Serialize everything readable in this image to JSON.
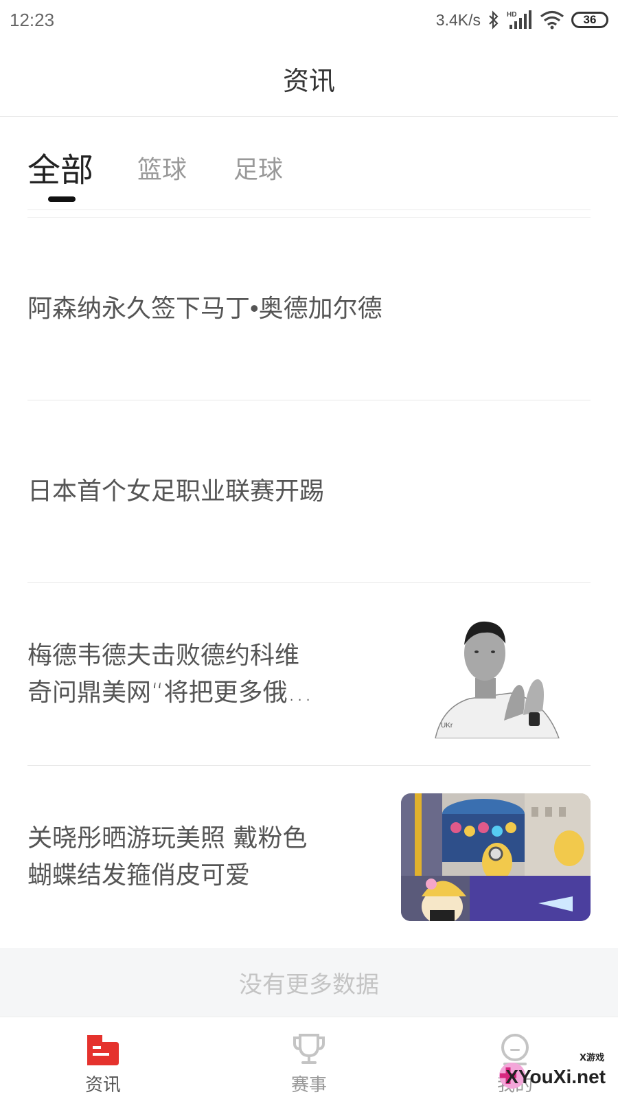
{
  "status_bar": {
    "time": "12:23",
    "speed": "3.4K/s",
    "battery": "36",
    "icons": [
      "bluetooth-icon",
      "hd-signal-icon",
      "wifi-icon",
      "battery-icon"
    ]
  },
  "header": {
    "title": "资讯"
  },
  "tabs": [
    {
      "label": "全部",
      "active": true
    },
    {
      "label": "篮球",
      "active": false
    },
    {
      "label": "足球",
      "active": false
    }
  ],
  "news": [
    {
      "title": "阿森纳永久签下马丁•奥德加尔德",
      "has_image": false
    },
    {
      "title": "日本首个女足职业联赛开踢",
      "has_image": false
    },
    {
      "title": "梅德韦德夫击败德约科维\n奇问鼎美网“将把更多俄…",
      "has_image": true,
      "image": "tennis-player-photo"
    },
    {
      "title": "关晓彤晒游玩美照  戴粉色\n蝴蝶结发箍俏皮可爱",
      "has_image": true,
      "image": "amusement-park-photo"
    }
  ],
  "footer": {
    "no_more": "没有更多数据"
  },
  "bottom_nav": [
    {
      "label": "资讯",
      "icon": "news-icon",
      "active": true
    },
    {
      "label": "赛事",
      "icon": "trophy-icon",
      "active": false
    },
    {
      "label": "我的",
      "icon": "profile-icon",
      "active": false
    }
  ],
  "watermark": {
    "text": "XYouXi.net",
    "small": "X游戏"
  },
  "colors": {
    "accent": "#e5322d",
    "active_text": "#222222",
    "inactive_text": "#999999"
  }
}
